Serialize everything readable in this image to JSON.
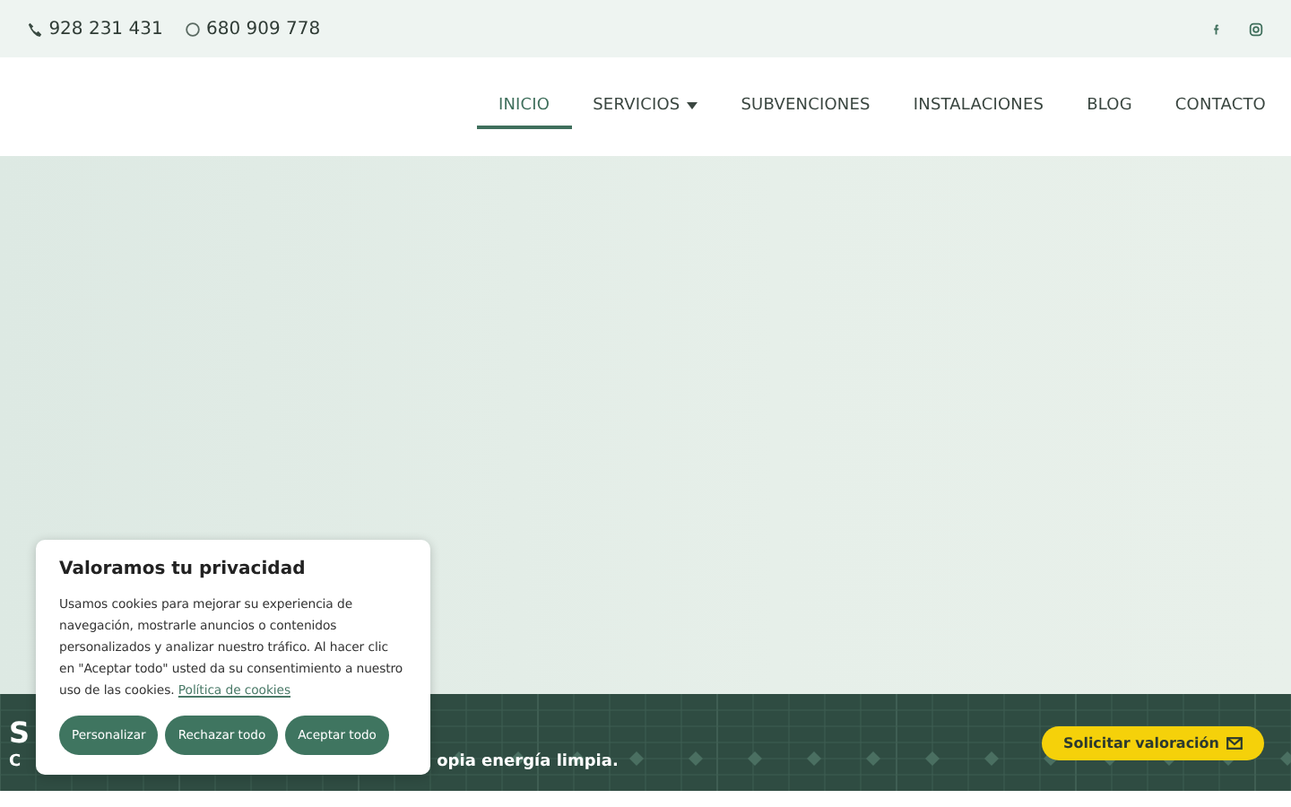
{
  "topbar": {
    "phone": "928 231 431",
    "whatsapp": "680 909 778"
  },
  "nav": [
    {
      "label": "INICIO",
      "selected": true,
      "dropdown": false
    },
    {
      "label": "SERVICIOS",
      "selected": false,
      "dropdown": true
    },
    {
      "label": "SUBVENCIONES",
      "selected": false,
      "dropdown": false
    },
    {
      "label": "INSTALACIONES",
      "selected": false,
      "dropdown": false
    },
    {
      "label": "BLOG",
      "selected": false,
      "dropdown": false
    },
    {
      "label": "CONTACTO",
      "selected": false,
      "dropdown": false
    }
  ],
  "banner": {
    "heading": "S",
    "subtitle_start": "C",
    "subtitle_end": "opia energía limpia.",
    "button": "Solicitar valoración"
  },
  "cookie_dialog": {
    "title": "Valoramos tu privacidad",
    "text": "Usamos cookies para mejorar su experiencia de navegación, mostrarle anuncios o contenidos personalizados y analizar nuestro tráfico. Al hacer clic en \"Aceptar todo\" usted da su consentimiento a nuestro uso de las cookies.",
    "link": "Política de cookies",
    "buttons": [
      "Personalizar",
      "Rechazar todo",
      "Aceptar todo"
    ]
  }
}
